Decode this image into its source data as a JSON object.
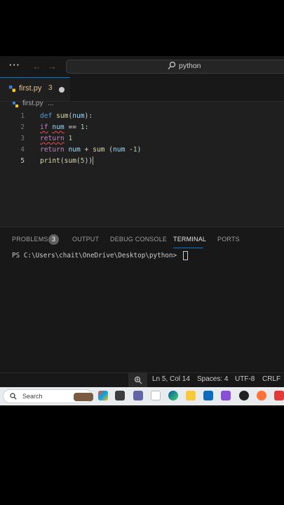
{
  "titlebar": {
    "search_text": "python"
  },
  "tab": {
    "filename": "first.py",
    "problem_count": "3"
  },
  "breadcrumb": {
    "file": "first.py",
    "more": "..."
  },
  "editor": {
    "line_numbers": [
      "1",
      "2",
      "3",
      "4",
      "5"
    ],
    "lines": [
      "def sum(num):",
      "if num == 1:",
      "return 1",
      "return num + sum (num -1)",
      "print(sum(5))"
    ]
  },
  "panel": {
    "tabs": [
      "PROBLEMS",
      "OUTPUT",
      "DEBUG CONSOLE",
      "TERMINAL",
      "PORTS"
    ],
    "problems_badge": "3",
    "active_tab": "TERMINAL",
    "terminal_prompt": "PS C:\\Users\\chait\\OneDrive\\Desktop\\python> "
  },
  "statusbar": {
    "position": "Ln 5, Col 14",
    "spaces": "Spaces: 4",
    "encoding": "UTF-8",
    "eol": "CRLF"
  },
  "taskbar": {
    "search_placeholder": "Search"
  },
  "colors": {
    "accent": "#0078d4",
    "modified_tab": "#e2c08d",
    "error_squiggle": "#f14c4c"
  }
}
